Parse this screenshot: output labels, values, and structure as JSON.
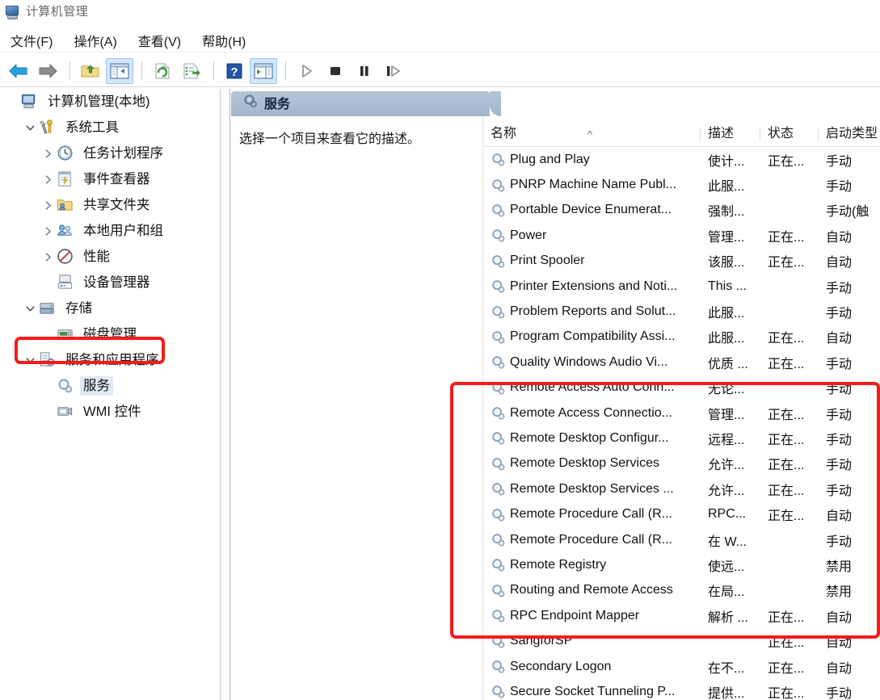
{
  "window": {
    "title": "计算机管理",
    "icon": "computer-management-icon"
  },
  "menubar": {
    "items": [
      {
        "label": "文件(F)",
        "name": "menu-file"
      },
      {
        "label": "操作(A)",
        "name": "menu-action"
      },
      {
        "label": "查看(V)",
        "name": "menu-view"
      },
      {
        "label": "帮助(H)",
        "name": "menu-help"
      }
    ]
  },
  "toolbar": {
    "buttons": [
      {
        "name": "back-icon",
        "icon": "back-arrow",
        "active": false
      },
      {
        "name": "forward-icon",
        "icon": "forward-arrow",
        "active": false
      },
      {
        "name": "up-one-level-icon",
        "icon": "folder-up",
        "active": false
      },
      {
        "name": "show-hide-tree-icon",
        "icon": "tree-pane",
        "active": true
      },
      {
        "name": "refresh-icon",
        "icon": "refresh",
        "active": false
      },
      {
        "name": "export-list-icon",
        "icon": "export-list",
        "active": false
      },
      {
        "name": "help-icon",
        "icon": "question-mark",
        "active": false
      },
      {
        "name": "show-action-pane-icon",
        "icon": "action-pane",
        "active": true
      },
      {
        "name": "start-service-icon",
        "icon": "play-triangle",
        "active": false
      },
      {
        "name": "stop-service-icon",
        "icon": "stop-square",
        "active": false
      },
      {
        "name": "pause-service-icon",
        "icon": "pause-bars",
        "active": false
      },
      {
        "name": "restart-service-icon",
        "icon": "restart-arrow",
        "active": false
      }
    ]
  },
  "tree": {
    "items": [
      {
        "label": "计算机管理(本地)",
        "depth": 0,
        "twisty": "none",
        "icon": "computer-icon",
        "selected": false
      },
      {
        "label": "系统工具",
        "depth": 1,
        "twisty": "expanded",
        "icon": "system-tools-icon",
        "selected": false
      },
      {
        "label": "任务计划程序",
        "depth": 2,
        "twisty": "collapsed",
        "icon": "task-scheduler-icon",
        "selected": false
      },
      {
        "label": "事件查看器",
        "depth": 2,
        "twisty": "collapsed",
        "icon": "event-viewer-icon",
        "selected": false
      },
      {
        "label": "共享文件夹",
        "depth": 2,
        "twisty": "collapsed",
        "icon": "shared-folders-icon",
        "selected": false
      },
      {
        "label": "本地用户和组",
        "depth": 2,
        "twisty": "collapsed",
        "icon": "local-users-icon",
        "selected": false
      },
      {
        "label": "性能",
        "depth": 2,
        "twisty": "collapsed",
        "icon": "performance-icon",
        "selected": false
      },
      {
        "label": "设备管理器",
        "depth": 2,
        "twisty": "none",
        "icon": "device-manager-icon",
        "selected": false
      },
      {
        "label": "存储",
        "depth": 1,
        "twisty": "expanded",
        "icon": "storage-icon",
        "selected": false
      },
      {
        "label": "磁盘管理",
        "depth": 2,
        "twisty": "none",
        "icon": "disk-management-icon",
        "selected": false
      },
      {
        "label": "服务和应用程序",
        "depth": 1,
        "twisty": "expanded",
        "icon": "services-apps-icon",
        "selected": false
      },
      {
        "label": "服务",
        "depth": 2,
        "twisty": "none",
        "icon": "services-gear-icon",
        "selected": true
      },
      {
        "label": "WMI 控件",
        "depth": 2,
        "twisty": "none",
        "icon": "wmi-control-icon",
        "selected": false
      }
    ]
  },
  "content": {
    "pane_title": "服务",
    "pane_icon": "services-gear-icon",
    "description_placeholder": "选择一个项目来查看它的描述。",
    "columns": [
      {
        "label": "名称",
        "name": "column-name",
        "sorted": "asc"
      },
      {
        "label": "描述",
        "name": "column-description",
        "sorted": "none"
      },
      {
        "label": "状态",
        "name": "column-status",
        "sorted": "none"
      },
      {
        "label": "启动类型",
        "name": "column-startup-type",
        "sorted": "none"
      }
    ],
    "sort_indicator": "^",
    "rows": [
      {
        "name": "Plug and Play",
        "description": "使计...",
        "status": "正在...",
        "startup": "手动"
      },
      {
        "name": "PNRP Machine Name Publ...",
        "description": "此服...",
        "status": "",
        "startup": "手动"
      },
      {
        "name": "Portable Device Enumerat...",
        "description": "强制...",
        "status": "",
        "startup": "手动(触"
      },
      {
        "name": "Power",
        "description": "管理...",
        "status": "正在...",
        "startup": "自动"
      },
      {
        "name": "Print Spooler",
        "description": "该服...",
        "status": "正在...",
        "startup": "自动"
      },
      {
        "name": "Printer Extensions and Noti...",
        "description": "This ...",
        "status": "",
        "startup": "手动"
      },
      {
        "name": "Problem Reports and Solut...",
        "description": "此服...",
        "status": "",
        "startup": "手动"
      },
      {
        "name": "Program Compatibility Assi...",
        "description": "此服...",
        "status": "正在...",
        "startup": "自动"
      },
      {
        "name": "Quality Windows Audio Vi...",
        "description": "优质 ...",
        "status": "正在...",
        "startup": "手动"
      },
      {
        "name": "Remote Access Auto Conn...",
        "description": "无论...",
        "status": "",
        "startup": "手动"
      },
      {
        "name": "Remote Access Connectio...",
        "description": "管理...",
        "status": "正在...",
        "startup": "手动"
      },
      {
        "name": "Remote Desktop Configur...",
        "description": "远程...",
        "status": "正在...",
        "startup": "手动"
      },
      {
        "name": "Remote Desktop Services",
        "description": "允许...",
        "status": "正在...",
        "startup": "手动"
      },
      {
        "name": "Remote Desktop Services ...",
        "description": "允许...",
        "status": "正在...",
        "startup": "手动"
      },
      {
        "name": "Remote Procedure Call (R...",
        "description": "RPC...",
        "status": "正在...",
        "startup": "自动"
      },
      {
        "name": "Remote Procedure Call (R...",
        "description": "在 W...",
        "status": "",
        "startup": "手动"
      },
      {
        "name": "Remote Registry",
        "description": "使远...",
        "status": "",
        "startup": "禁用"
      },
      {
        "name": "Routing and Remote Access",
        "description": "在局...",
        "status": "",
        "startup": "禁用"
      },
      {
        "name": "RPC Endpoint Mapper",
        "description": "解析 ...",
        "status": "正在...",
        "startup": "自动"
      },
      {
        "name": "SangforSP",
        "description": "",
        "status": "正在...",
        "startup": "自动"
      },
      {
        "name": "Secondary Logon",
        "description": "在不...",
        "status": "正在...",
        "startup": "自动"
      },
      {
        "name": "Secure Socket Tunneling P...",
        "description": "提供...",
        "status": "正在...",
        "startup": "手动"
      }
    ]
  },
  "annotations": {
    "color": "#f41b1b",
    "boxes": [
      {
        "name": "annotation-box-services-tree-item",
        "target": "服务"
      },
      {
        "name": "annotation-box-remote-services",
        "target": "Remote / RPC services"
      }
    ]
  }
}
